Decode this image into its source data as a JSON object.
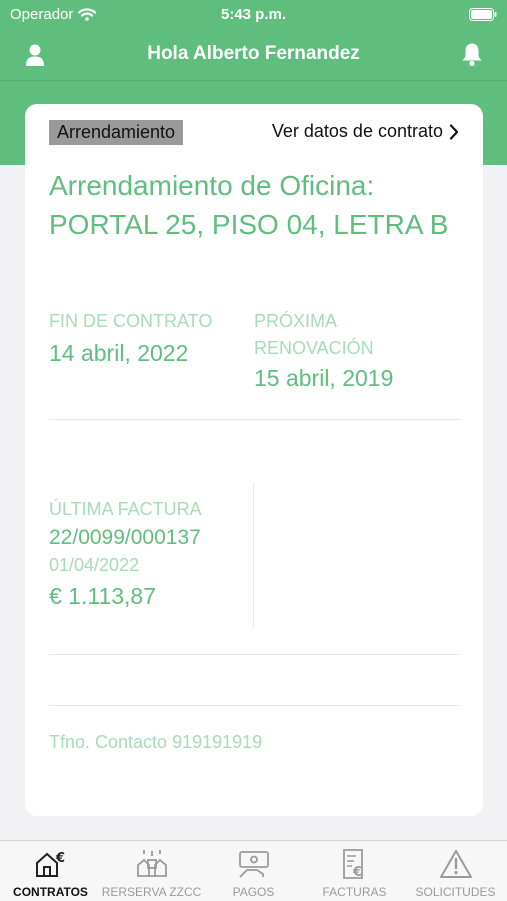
{
  "status_bar": {
    "carrier": "Operador",
    "time": "5:43 p.m."
  },
  "header": {
    "title": "Hola Alberto Fernandez"
  },
  "card": {
    "tag": "Arrendamiento",
    "view_link": "Ver datos de contrato",
    "title": "Arrendamiento de Oficina: PORTAL 25, PISO 04, LETRA B",
    "end_label": "FIN DE CONTRATO",
    "end_value": "14 abril, 2022",
    "renewal_label": "PRÓXIMA RENOVACIÓN",
    "renewal_value": "15 abril, 2019",
    "invoice_label": "ÚLTIMA FACTURA",
    "invoice_number": "22/0099/000137",
    "invoice_date": "01/04/2022",
    "invoice_amount": "€ 1.113,87",
    "contact": "Tfno. Contacto 919191919"
  },
  "tabs": [
    {
      "label": "CONTRATOS",
      "icon": "house-euro-icon",
      "active": true
    },
    {
      "label": "RERSERVA ZZCC",
      "icon": "hands-icon",
      "active": false
    },
    {
      "label": "PAGOS",
      "icon": "card-hand-icon",
      "active": false
    },
    {
      "label": "FACTURAS",
      "icon": "invoice-euro-icon",
      "active": false
    },
    {
      "label": "SOLICITUDES",
      "icon": "warning-icon",
      "active": false
    }
  ],
  "colors": {
    "brand_green": "#5fbe7d",
    "light_green": "#a8dcb7"
  }
}
